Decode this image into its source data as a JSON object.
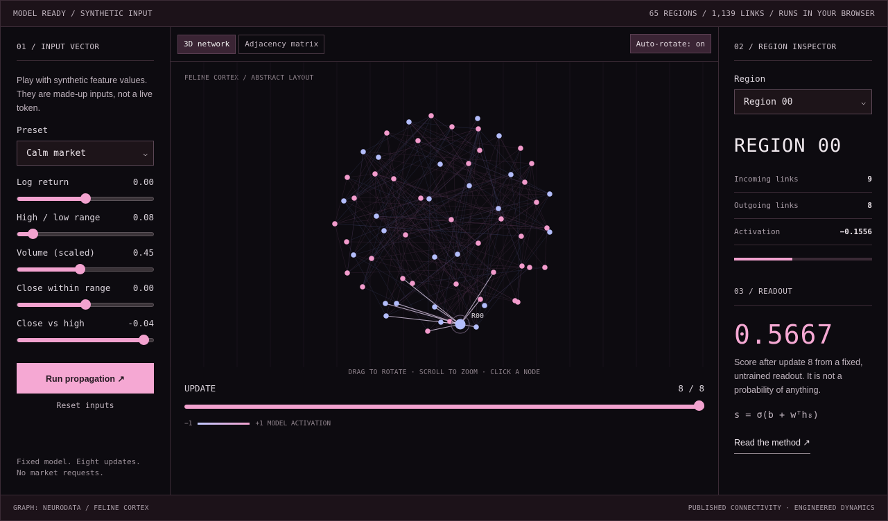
{
  "topbar": {
    "status": "MODEL READY / SYNTHETIC INPUT",
    "summary": "65 REGIONS / 1,139 LINKS / RUNS IN YOUR BROWSER"
  },
  "input": {
    "title": "01 / INPUT VECTOR",
    "intro": "Play with synthetic feature values. They are made-up inputs, not a live token.",
    "preset_label": "Preset",
    "preset_value": "Calm market",
    "sliders": [
      {
        "label": "Log return",
        "value": "0.00",
        "fraction": 0.5
      },
      {
        "label": "High / low range",
        "value": "0.08",
        "fraction": 0.11
      },
      {
        "label": "Volume (scaled)",
        "value": "0.45",
        "fraction": 0.46
      },
      {
        "label": "Close within range",
        "value": "0.00",
        "fraction": 0.5
      },
      {
        "label": "Close vs high",
        "value": "-0.04",
        "fraction": 0.93
      }
    ],
    "run_label": "Run propagation ↗",
    "reset_label": "Reset inputs",
    "note_line1": "Fixed model. Eight updates.",
    "note_line2": "No market requests."
  },
  "graph": {
    "tab_3d": "3D network",
    "tab_matrix": "Adjacency matrix",
    "autorotate": "Auto-rotate: on",
    "caption": "FELINE CORTEX / ABSTRACT LAYOUT",
    "hint": "DRAG TO ROTATE · SCROLL TO ZOOM · CLICK A NODE",
    "selected_label": "R00",
    "update_label": "UPDATE",
    "update_value": "8 / 8",
    "update_fraction": 1.0,
    "legend_min": "−1",
    "legend_max": "+1 MODEL ACTIVATION",
    "colors": {
      "negative": "#b3bdfb",
      "positive": "#f29bcc"
    }
  },
  "inspector": {
    "title": "02 / REGION INSPECTOR",
    "region_label": "Region",
    "region_value": "Region 00",
    "region_big": "REGION 00",
    "stats": [
      {
        "label": "Incoming links",
        "value": "9"
      },
      {
        "label": "Outgoing links",
        "value": "8"
      },
      {
        "label": "Activation",
        "value": "−0.1556"
      }
    ],
    "activation_fraction": 0.42
  },
  "readout": {
    "title": "03 / READOUT",
    "score": "0.5667",
    "desc": "Score after update 8 from a fixed, untrained readout. It is not a probability of anything.",
    "formula": "s = σ(b + wᵀh₈)",
    "method_link": "Read the method ↗"
  },
  "bottombar": {
    "left": "GRAPH: NEURODATA / FELINE CORTEX",
    "right": "PUBLISHED CONNECTIVITY · ENGINEERED DYNAMICS"
  }
}
